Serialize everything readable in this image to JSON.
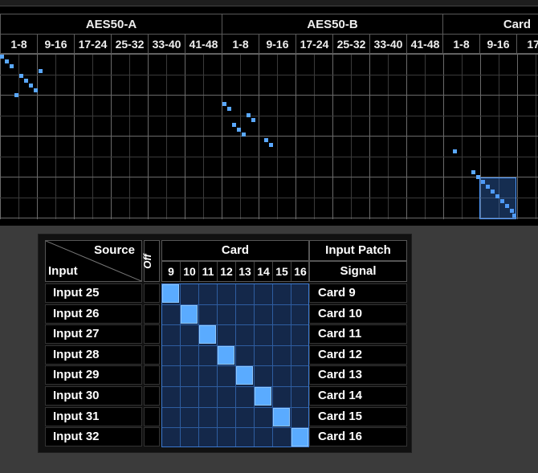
{
  "overview": {
    "groups": [
      {
        "label": "AES50-A",
        "subs": [
          "1-8",
          "9-16",
          "17-24",
          "25-32",
          "33-40",
          "41-48"
        ]
      },
      {
        "label": "AES50-B",
        "subs": [
          "1-8",
          "9-16",
          "17-24",
          "25-32",
          "33-40",
          "41-48"
        ]
      },
      {
        "label": "Card",
        "subs": [
          "1-8",
          "9-16",
          "17-"
        ]
      }
    ]
  },
  "detail": {
    "source_label": "Source",
    "input_label": "Input",
    "off_label": "Off",
    "group_label": "Card",
    "patch_label": "Input Patch",
    "signal_label": "Signal",
    "columns": [
      "9",
      "10",
      "11",
      "12",
      "13",
      "14",
      "15",
      "16"
    ],
    "rows": [
      {
        "input": "Input 25",
        "signal": "Card 9",
        "patched_col": 0
      },
      {
        "input": "Input 26",
        "signal": "Card 10",
        "patched_col": 1
      },
      {
        "input": "Input 27",
        "signal": "Card 11",
        "patched_col": 2
      },
      {
        "input": "Input 28",
        "signal": "Card 12",
        "patched_col": 3
      },
      {
        "input": "Input 29",
        "signal": "Card 13",
        "patched_col": 4
      },
      {
        "input": "Input 30",
        "signal": "Card 14",
        "patched_col": 5
      },
      {
        "input": "Input 31",
        "signal": "Card 15",
        "patched_col": 6
      },
      {
        "input": "Input 32",
        "signal": "Card 16",
        "patched_col": 7
      }
    ]
  },
  "colors": {
    "patch_active": "#5aabff",
    "grid_bg": "#14284a",
    "accent": "#3a78d0"
  }
}
